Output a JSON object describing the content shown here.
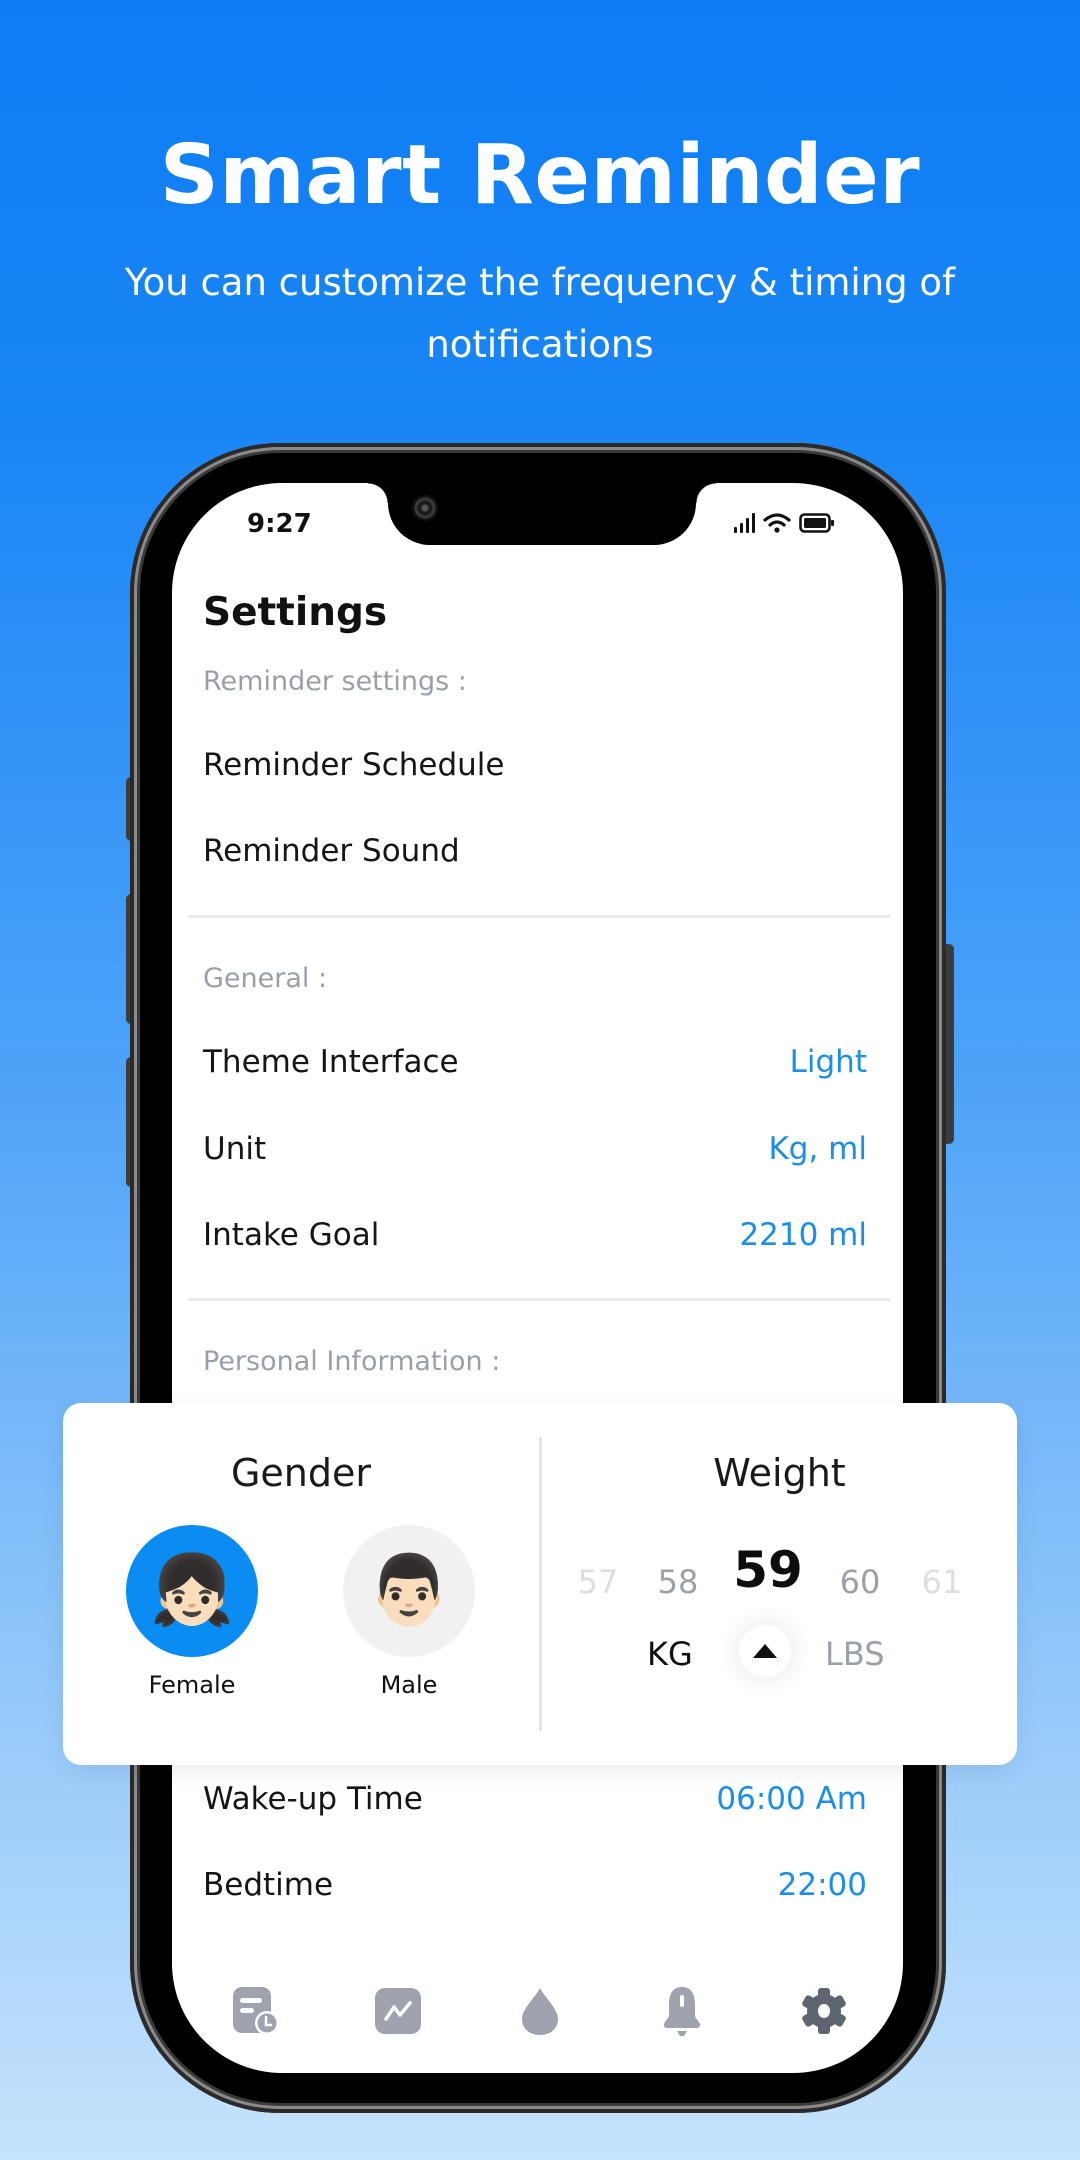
{
  "hero": {
    "title": "Smart Reminder",
    "subtitle": "You can customize the frequency & timing of notifications"
  },
  "status_bar": {
    "time": "9:27",
    "icons": [
      "signal-icon",
      "wifi-icon",
      "battery-icon"
    ]
  },
  "settings": {
    "title": "Settings",
    "sections": {
      "reminder": {
        "label": "Reminder settings :",
        "items": [
          {
            "label": "Reminder Schedule"
          },
          {
            "label": "Reminder Sound"
          }
        ]
      },
      "general": {
        "label": "General :",
        "items": [
          {
            "label": "Theme Interface",
            "value": "Light"
          },
          {
            "label": "Unit",
            "value": "Kg, ml"
          },
          {
            "label": "Intake Goal",
            "value": "2210 ml"
          }
        ]
      },
      "personal": {
        "label": "Personal Information :",
        "items": [
          {
            "label": "Wake-up Time",
            "value": "06:00 Am"
          },
          {
            "label": "Bedtime",
            "value": "22:00"
          }
        ]
      }
    }
  },
  "card": {
    "gender": {
      "heading": "Gender",
      "options": [
        {
          "label": "Female",
          "emoji": "👧🏻",
          "selected": true
        },
        {
          "label": "Male",
          "emoji": "👨🏻",
          "selected": false
        }
      ]
    },
    "weight": {
      "heading": "Weight",
      "values": [
        "57",
        "58",
        "59",
        "60",
        "61"
      ],
      "selected": "59",
      "units": {
        "kg": "KG",
        "lbs": "LBS",
        "selected": "KG"
      }
    }
  },
  "tabbar": {
    "items": [
      {
        "icon": "history-icon",
        "active": false
      },
      {
        "icon": "chart-icon",
        "active": false
      },
      {
        "icon": "water-drop-icon",
        "active": false
      },
      {
        "icon": "bell-icon",
        "active": false
      },
      {
        "icon": "gear-icon",
        "active": true
      }
    ]
  },
  "colors": {
    "accent": "#1a8ee8",
    "selected_gender_bg": "#0a8cf2",
    "section_label": "#9aa0aa",
    "tab_inactive": "#9ea3ad",
    "tab_active": "#5d6570"
  }
}
